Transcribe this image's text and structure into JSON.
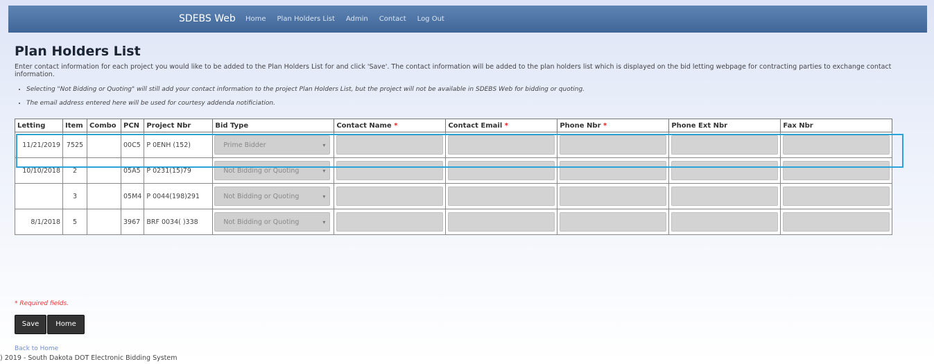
{
  "nav": {
    "brand": "SDEBS Web",
    "links": [
      "Home",
      "Plan Holders List",
      "Admin",
      "Contact",
      "Log Out"
    ]
  },
  "page": {
    "title": "Plan Holders List",
    "intro": "Enter contact information for each project you would like to be added to the Plan Holders List for and click 'Save'. The contact information will be added to the plan holders list which is displayed on the bid letting webpage for contracting parties to exchange contact information.",
    "notes": [
      "Selecting \"Not Bidding or Quoting\" will still add your contact information to the project Plan Holders List, but the project will not be available in SDEBS Web for bidding or quoting.",
      "The email address entered here will be used for courtesy addenda notificiation."
    ]
  },
  "table": {
    "headers": {
      "letting": "Letting",
      "item": "Item",
      "combo": "Combo",
      "pcn": "PCN",
      "project": "Project Nbr",
      "bid_type": "Bid Type",
      "contact_name": "Contact Name",
      "contact_email": "Contact Email",
      "phone": "Phone Nbr",
      "phone_ext": "Phone Ext Nbr",
      "fax": "Fax Nbr"
    },
    "required_marker": "*",
    "rows": [
      {
        "letting": "11/21/2019",
        "item": "7525",
        "combo": "",
        "pcn": "00C5",
        "project": "P 0ENH (152)",
        "bid_type": "Prime Bidder"
      },
      {
        "letting": "10/10/2018",
        "item": "2",
        "combo": "",
        "pcn": "05A5",
        "project": "P 0231(15)79",
        "bid_type": "Not Bidding or Quoting"
      },
      {
        "letting": "",
        "item": "3",
        "combo": "",
        "pcn": "05M4",
        "project": "P 0044(198)291",
        "bid_type": "Not Bidding or Quoting"
      },
      {
        "letting": "8/1/2018",
        "item": "5",
        "combo": "",
        "pcn": "3967",
        "project": "BRF 0034( )338",
        "bid_type": "Not Bidding or Quoting"
      }
    ]
  },
  "required_note": "* Required fields.",
  "buttons": {
    "save": "Save",
    "home": "Home"
  },
  "back_link": "Back to Home",
  "footer": ") 2019 - South Dakota DOT Electronic Bidding System",
  "colors": {
    "navbar": "#3f6697",
    "highlight": "#2aa4d8",
    "required": "#e02020"
  }
}
